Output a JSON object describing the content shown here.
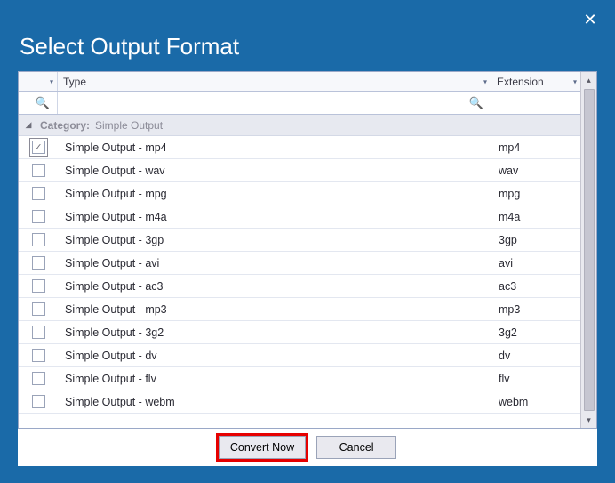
{
  "dialog": {
    "title": "Select Output Format"
  },
  "columns": {
    "type": "Type",
    "extension": "Extension"
  },
  "group": {
    "label": "Category:",
    "name": "Simple Output"
  },
  "rows": [
    {
      "type": "Simple Output - mp4",
      "ext": "mp4",
      "checked": true,
      "selected": true
    },
    {
      "type": "Simple Output - wav",
      "ext": "wav",
      "checked": false,
      "selected": false
    },
    {
      "type": "Simple Output - mpg",
      "ext": "mpg",
      "checked": false,
      "selected": false
    },
    {
      "type": "Simple Output - m4a",
      "ext": "m4a",
      "checked": false,
      "selected": false
    },
    {
      "type": "Simple Output - 3gp",
      "ext": "3gp",
      "checked": false,
      "selected": false
    },
    {
      "type": "Simple Output - avi",
      "ext": "avi",
      "checked": false,
      "selected": false
    },
    {
      "type": "Simple Output - ac3",
      "ext": "ac3",
      "checked": false,
      "selected": false
    },
    {
      "type": "Simple Output - mp3",
      "ext": "mp3",
      "checked": false,
      "selected": false
    },
    {
      "type": "Simple Output - 3g2",
      "ext": "3g2",
      "checked": false,
      "selected": false
    },
    {
      "type": "Simple Output - dv",
      "ext": "dv",
      "checked": false,
      "selected": false
    },
    {
      "type": "Simple Output - flv",
      "ext": "flv",
      "checked": false,
      "selected": false
    },
    {
      "type": "Simple Output - webm",
      "ext": "webm",
      "checked": false,
      "selected": false
    }
  ],
  "buttons": {
    "convert": "Convert Now",
    "cancel": "Cancel"
  },
  "icons": {
    "close": "✕",
    "search": "🔍",
    "caret": "▾",
    "expand": "◢",
    "up": "▴",
    "down": "▾"
  }
}
